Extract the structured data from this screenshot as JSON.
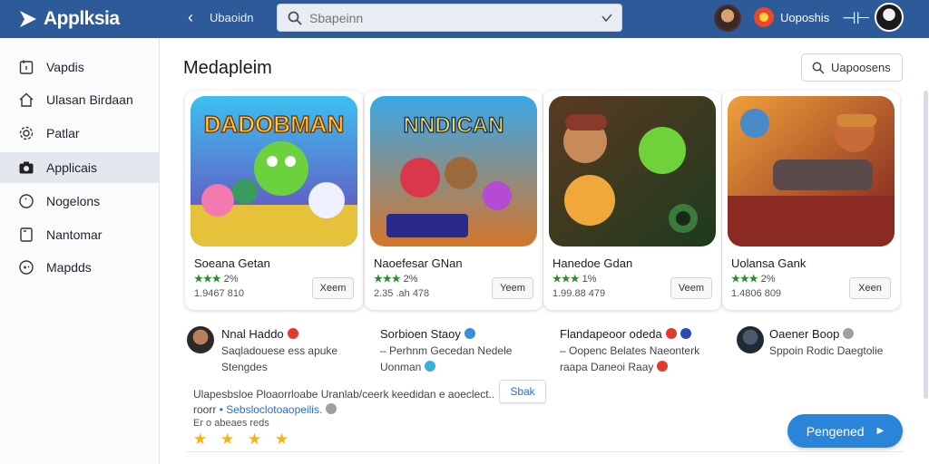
{
  "app": {
    "name": "Applksia"
  },
  "header": {
    "breadcrumb": "Ubaoidn",
    "search": {
      "value": "",
      "placeholder": "Sbapeinn"
    },
    "user_label": "Uoposhis"
  },
  "sidebar": {
    "items": [
      {
        "label": "Vapdis",
        "icon": "calendar-icon"
      },
      {
        "label": "Ulasan Birdaan",
        "icon": "home-icon"
      },
      {
        "label": "Patlar",
        "icon": "gear-icon"
      },
      {
        "label": "Applicais",
        "icon": "camera-icon",
        "active": true
      },
      {
        "label": "Nogelons",
        "icon": "info-icon"
      },
      {
        "label": "Nantomar",
        "icon": "bookmark-icon"
      },
      {
        "label": "Mapdds",
        "icon": "gamepad-icon"
      }
    ]
  },
  "main": {
    "title": "Medapleim",
    "filter_label": "Uapoosens",
    "cards": [
      {
        "name": "Soeana Getan",
        "rating": "★★★",
        "review_count": "2%",
        "meta": "1.9467 810",
        "button": "Xeem",
        "art_title": "DADOBMAN"
      },
      {
        "name": "Naoefesar GNan",
        "rating": "★★★",
        "review_count": "2%",
        "meta": "2.35 .ah 478",
        "button": "Yeem",
        "art_title": "NNDICAN"
      },
      {
        "name": "Hanedoe Gdan",
        "rating": "★★★",
        "review_count": "1%",
        "meta": "1.99.88 479",
        "button": "Veem",
        "art_title": ""
      },
      {
        "name": "Uolansa Gank",
        "rating": "★★★",
        "review_count": "2%",
        "meta": "1.4806 809",
        "button": "Xeen",
        "art_title": ""
      }
    ],
    "developers": [
      {
        "name": "Nnal Haddo",
        "line1": "Saqladouese ess apuke",
        "line2": "Stengdes",
        "badge_color": "#e23b2e",
        "avatar": "dev-avatar"
      },
      {
        "name": "Sorbioen Staoy",
        "line1": "– Perhnm Gecedan Nedele",
        "line2": "Uonman",
        "badge_color": "#3a8fd8",
        "avatar": "none"
      },
      {
        "name": "Flandapeoor odeda",
        "line1": "– Oopenc Belates Naeonterk",
        "line2": "raapa Daneoi Raay",
        "badge_color": "#e23b2e",
        "avatar": "none"
      },
      {
        "name": "Oaener Boop",
        "line1": "Sppoin Rodic Daegtolie",
        "line2": "",
        "badge_color": "#9aa0a6",
        "avatar": "dev-avatar"
      }
    ],
    "review": {
      "text1": "Ulapesbsloe Ploaorrloabe Uranlab/ceerk keedidan e aoeclect..",
      "text2_prefix": "roorr",
      "text2_link": "• Sebsloclotoaopeilis.",
      "text3": "Er o abeaes reds",
      "stars": "★ ★ ★ ★",
      "send_label": "Sbak"
    },
    "primary_button": "Pengened"
  }
}
